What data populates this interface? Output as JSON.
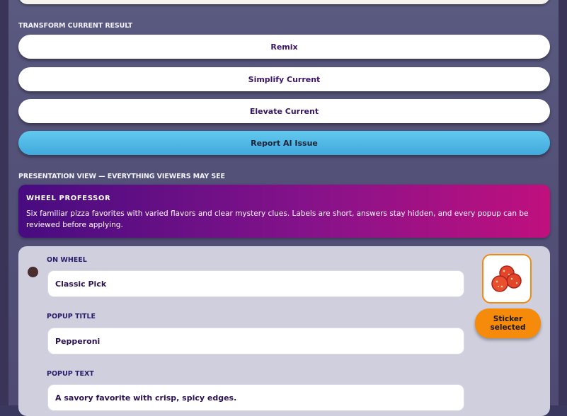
{
  "transform": {
    "section_label": "TRANSFORM CURRENT RESULT",
    "buttons": [
      "Remix",
      "Simplify Current",
      "Elevate Current"
    ],
    "report_label": "Report AI Issue"
  },
  "presentation": {
    "section_label": "PRESENTATION VIEW — EVERYTHING VIEWERS MAY SEE",
    "banner_title": "WHEEL PROFESSOR",
    "banner_text": "Six familiar pizza favorites with varied flavors and clear mystery clues. Labels are short, answers stay hidden, and every popup can be reviewed before applying."
  },
  "card": {
    "on_wheel_label": "ON WHEEL",
    "on_wheel_value": "Classic Pick",
    "popup_title_label": "POPUP TITLE",
    "popup_title_value": "Pepperoni",
    "popup_text_label": "POPUP TEXT",
    "popup_text_value": "A savory favorite with crisp, spicy edges.",
    "sticker_icon": "pepperoni-icon",
    "sticker_button_label": "Sticker selected"
  },
  "colors": {
    "accent_orange": "#f58a0b",
    "report_blue": "#4fb8e6",
    "banner_start": "#470c80",
    "banner_end": "#c0107e"
  }
}
